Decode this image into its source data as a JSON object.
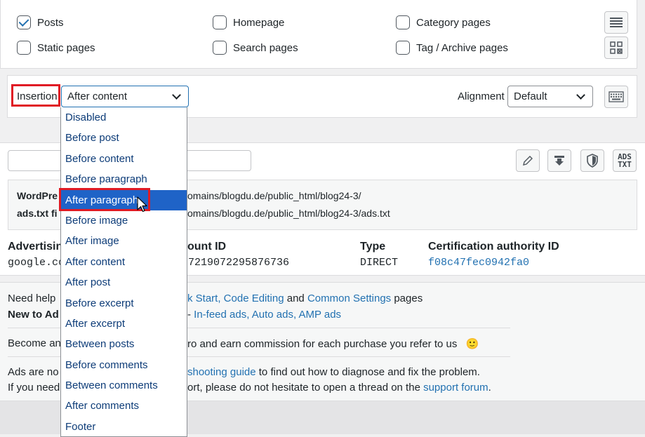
{
  "checkboxes": [
    {
      "label": "Posts",
      "checked": true
    },
    {
      "label": "Homepage",
      "checked": false
    },
    {
      "label": "Category pages",
      "checked": false
    },
    {
      "label": "Static pages",
      "checked": false
    },
    {
      "label": "Search pages",
      "checked": false
    },
    {
      "label": "Tag / Archive pages",
      "checked": false
    }
  ],
  "insertion": {
    "label": "Insertion",
    "selected": "After content",
    "options": [
      "Disabled",
      "Before post",
      "Before content",
      "Before paragraph",
      "After paragraph",
      "Before image",
      "After image",
      "After content",
      "After post",
      "Before excerpt",
      "After excerpt",
      "Between posts",
      "Before comments",
      "Between comments",
      "After comments",
      "Footer"
    ],
    "highlighted": "After paragraph"
  },
  "alignment": {
    "label": "Alignment",
    "selected": "Default"
  },
  "adstxt": {
    "icon_text_top": "ADS",
    "icon_text_bottom": "TXT",
    "wordpress_label": "WordPre",
    "wordpress_path": "omains/blogdu.de/public_html/blog24-3/",
    "adstxt_label": "ads.txt fi",
    "adstxt_path": "omains/blogdu.de/public_html/blog24-3/ads.txt",
    "columns": {
      "advertising": "Advertisin",
      "account": "ount ID",
      "type": "Type",
      "cert": "Certification authority ID"
    },
    "row": {
      "advertising": "google.co",
      "account": "-7219072295876736",
      "type": "DIRECT",
      "cert": "f08c47fec0942fa0"
    }
  },
  "help": {
    "line1_a": "Need help",
    "line1_b": "k Start, Code Editing",
    "line1_c": " and ",
    "line1_d": "Common Settings",
    "line1_e": " pages",
    "line2_a": "New to Ad",
    "line2_b": " - ",
    "line2_c": "In-feed ads, Auto ads, AMP ads",
    "line3_a": "Become an",
    "line3_b": "ro and earn commission for each purchase you refer to us",
    "line3_emoji": "🙂",
    "line4_a": "Ads are no",
    "line4_b": "shooting guide",
    "line4_c": " to find out how to diagnose and fix the problem.",
    "line5_a": "If you need",
    "line5_b": "ort, please do not hesitate to open a thread on the ",
    "line5_c": "support forum",
    "line5_d": "."
  },
  "colors": {
    "highlight_box": "#e01b24",
    "dropdown_highlight": "#1f63c7",
    "link": "#2271b1"
  }
}
